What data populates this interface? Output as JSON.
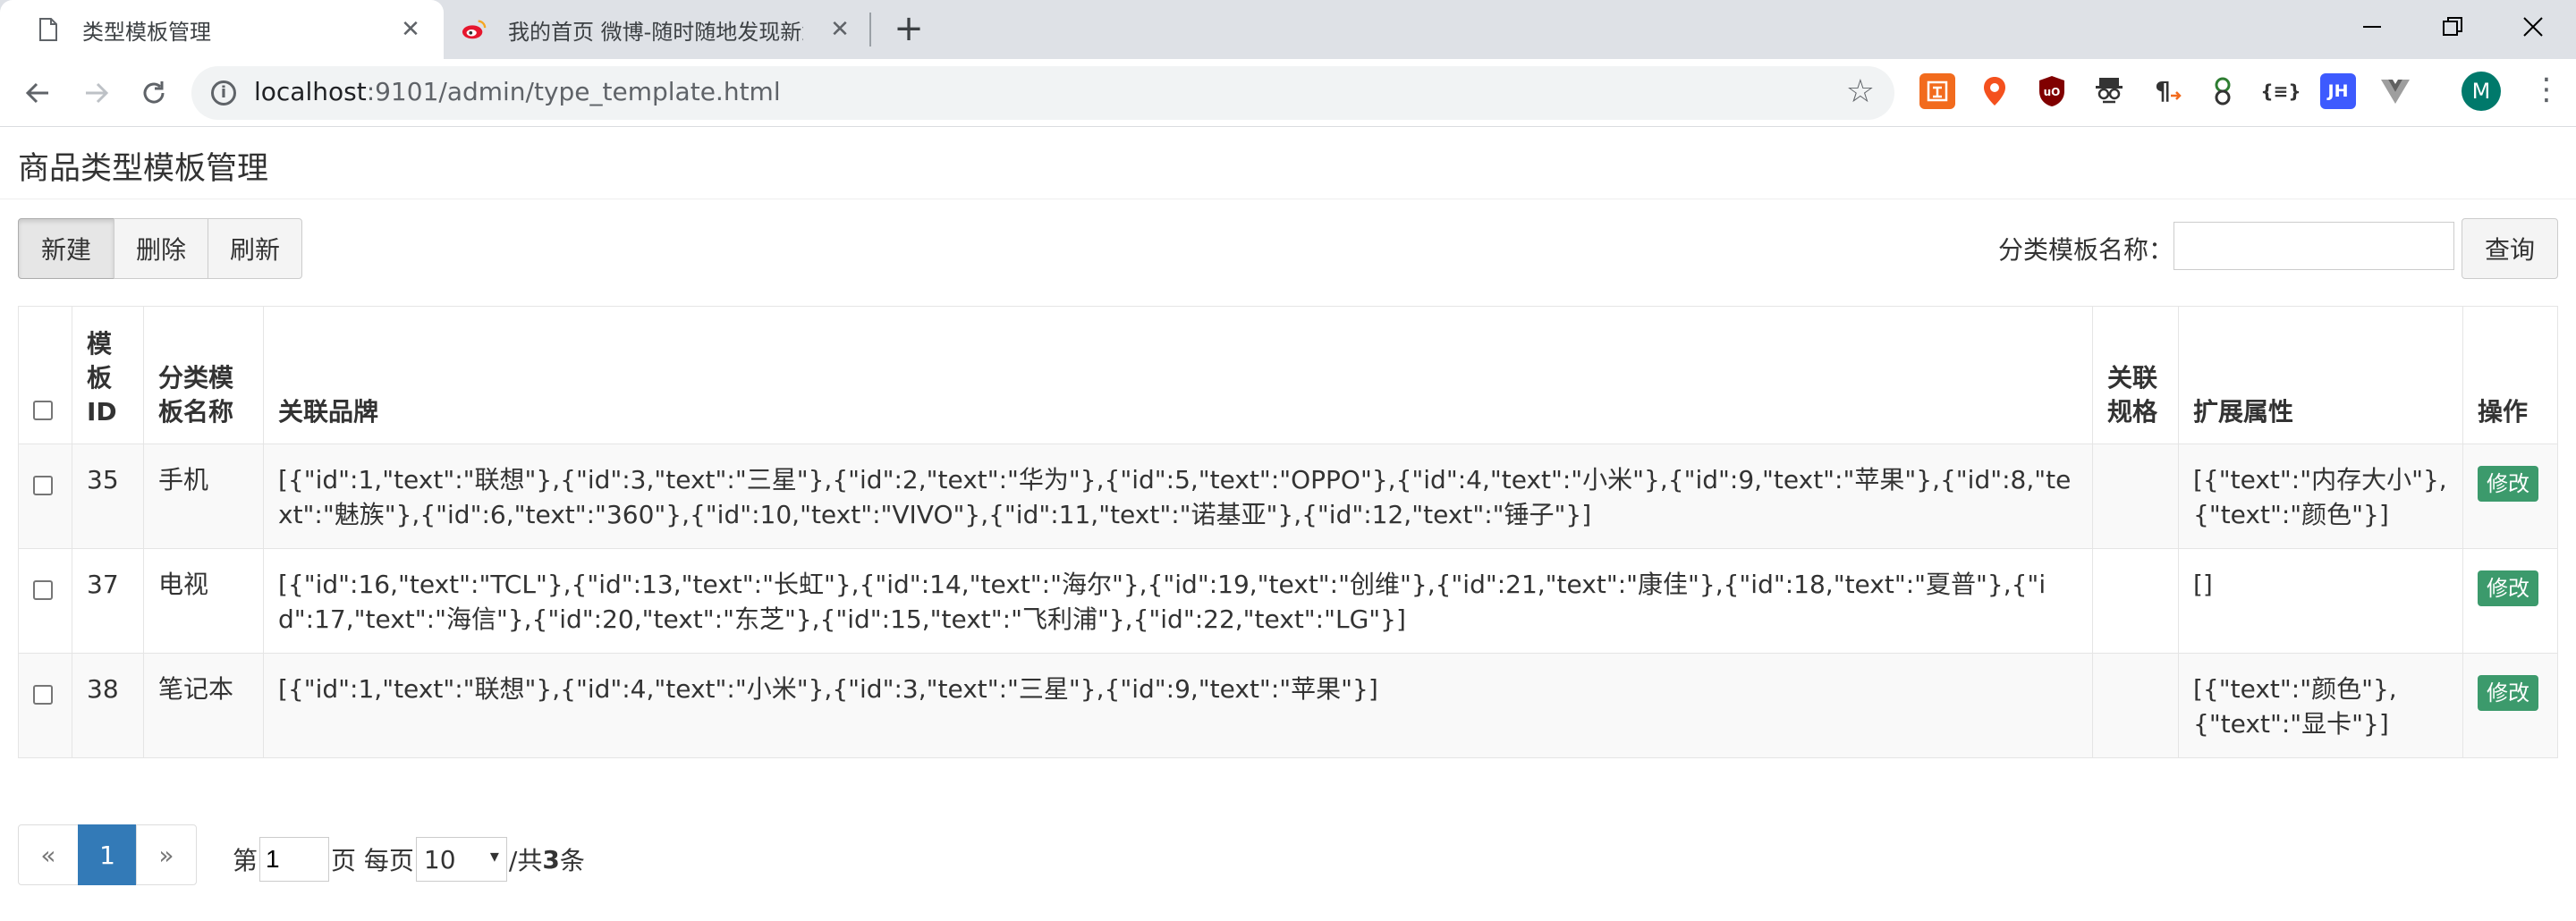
{
  "browser": {
    "tabs": [
      {
        "title": "类型模板管理",
        "icon": "document-icon",
        "active": true
      },
      {
        "title": "我的首页 微博-随时随地发现新鲜",
        "icon": "weibo-icon",
        "active": false
      }
    ],
    "url_host": "localhost",
    "url_path": ":9101/admin/type_template.html",
    "extensions": [
      "ext-orange-icon",
      "ext-location-icon",
      "ublock-icon",
      "ext-spy-icon",
      "ext-pilcrow-icon",
      "ext-leaf-icon",
      "json-viewer-icon",
      "jh-icon",
      "vue-devtools-icon"
    ],
    "extension_labels": {
      "json": "{≡}",
      "jh": "JH"
    },
    "profile_initial": "M"
  },
  "page": {
    "title": "商品类型模板管理",
    "toolbar": {
      "new_label": "新建",
      "delete_label": "删除",
      "refresh_label": "刷新"
    },
    "search": {
      "label": "分类模板名称：",
      "value": "",
      "button_label": "查询"
    }
  },
  "table": {
    "headers": {
      "id": "模板ID",
      "name": "分类模板名称",
      "brands": "关联品牌",
      "spec": "关联规格",
      "attrs": "扩展属性",
      "op": "操作"
    },
    "rows": [
      {
        "id": "35",
        "name": "手机",
        "brands": "[{\"id\":1,\"text\":\"联想\"},{\"id\":3,\"text\":\"三星\"},{\"id\":2,\"text\":\"华为\"},{\"id\":5,\"text\":\"OPPO\"},{\"id\":4,\"text\":\"小米\"},{\"id\":9,\"text\":\"苹果\"},{\"id\":8,\"text\":\"魅族\"},{\"id\":6,\"text\":\"360\"},{\"id\":10,\"text\":\"VIVO\"},{\"id\":11,\"text\":\"诺基亚\"},{\"id\":12,\"text\":\"锤子\"}]",
        "spec": "",
        "attrs": "[{\"text\":\"内存大小\"},{\"text\":\"颜色\"}]",
        "op": "修改"
      },
      {
        "id": "37",
        "name": "电视",
        "brands": "[{\"id\":16,\"text\":\"TCL\"},{\"id\":13,\"text\":\"长虹\"},{\"id\":14,\"text\":\"海尔\"},{\"id\":19,\"text\":\"创维\"},{\"id\":21,\"text\":\"康佳\"},{\"id\":18,\"text\":\"夏普\"},{\"id\":17,\"text\":\"海信\"},{\"id\":20,\"text\":\"东芝\"},{\"id\":15,\"text\":\"飞利浦\"},{\"id\":22,\"text\":\"LG\"}]",
        "spec": "",
        "attrs": "[]",
        "op": "修改"
      },
      {
        "id": "38",
        "name": "笔记本",
        "brands": "[{\"id\":1,\"text\":\"联想\"},{\"id\":4,\"text\":\"小米\"},{\"id\":3,\"text\":\"三星\"},{\"id\":9,\"text\":\"苹果\"}]",
        "spec": "",
        "attrs": "[{\"text\":\"颜色\"},{\"text\":\"显卡\"}]",
        "op": "修改"
      }
    ]
  },
  "pagination": {
    "prev": "«",
    "current": "1",
    "next": "»",
    "page_prefix": "第",
    "page_value": "1",
    "per_page_prefix": "页 每页",
    "per_page_value": "10",
    "total_prefix": "/共",
    "total": "3",
    "total_suffix": "条"
  },
  "colors": {
    "primary": "#337ab7",
    "edit_button": "#3c9a6c",
    "avatar": "#00796b"
  }
}
